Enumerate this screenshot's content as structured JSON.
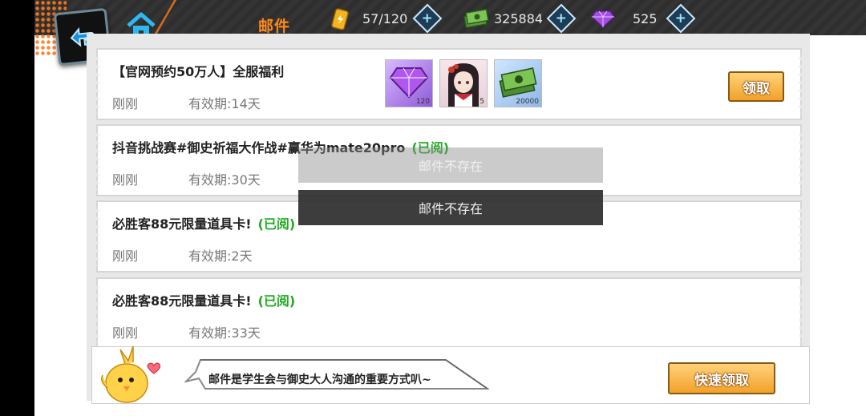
{
  "header": {
    "title": "邮件",
    "energy": "57/120",
    "money": "325884",
    "gems": "525"
  },
  "mails": [
    {
      "title": "【官网预约50万人】全服福利",
      "read_tag": "",
      "time": "刚刚",
      "expiry": "有效期:14天",
      "rewards": [
        {
          "icon": "purple-gem-icon",
          "count": "120"
        },
        {
          "icon": "character-portrait-icon",
          "count": "5"
        },
        {
          "icon": "cash-stack-icon",
          "count": "20000"
        }
      ],
      "claim_label": "领取"
    },
    {
      "title": "抖音挑战赛#御史祈福大作战#赢华为mate20pro",
      "read_tag": "(已阅)",
      "time": "刚刚",
      "expiry": "有效期:30天"
    },
    {
      "title": "必胜客88元限量道具卡!",
      "read_tag": "(已阅)",
      "time": "刚刚",
      "expiry": "有效期:2天"
    },
    {
      "title": "必胜客88元限量道具卡!",
      "read_tag": "(已阅)",
      "time": "刚刚",
      "expiry": "有效期:33天"
    }
  ],
  "toasts": [
    "邮件不存在",
    "邮件不存在"
  ],
  "footer": {
    "hint": "邮件是学生会与御史大人沟通的重要方式叭~",
    "quick_claim_label": "快速领取"
  }
}
